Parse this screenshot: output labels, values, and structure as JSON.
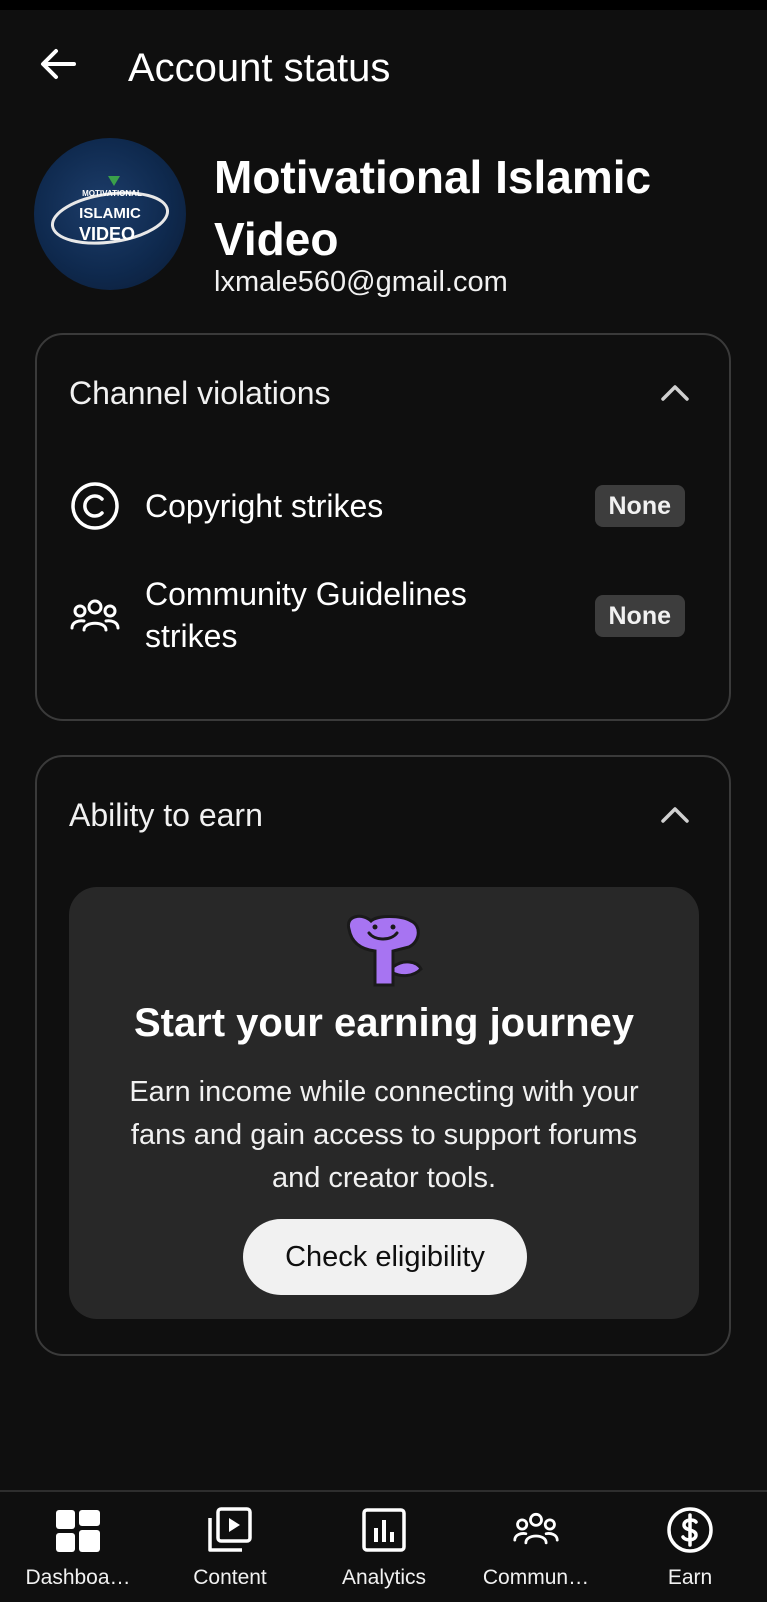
{
  "header": {
    "title": "Account status"
  },
  "channel": {
    "name": "Motivational Islamic Video",
    "email": "lxmale560@gmail.com",
    "avatar_text_top": "MOTIVATIONAL",
    "avatar_text_mid": "ISLAMIC",
    "avatar_text_bottom": "VIDEO"
  },
  "violations": {
    "title": "Channel violations",
    "items": [
      {
        "label": "Copyright strikes",
        "status": "None",
        "icon": "copyright-icon"
      },
      {
        "label": "Community Guidelines strikes",
        "status": "None",
        "icon": "people-icon"
      }
    ]
  },
  "earn": {
    "title": "Ability to earn",
    "card_title": "Start your earning journey",
    "card_desc": "Earn income while connecting with your fans and gain access to support forums and creator tools.",
    "button_label": "Check eligibility"
  },
  "nav": {
    "items": [
      {
        "label": "Dashboa…",
        "icon": "dashboard-icon"
      },
      {
        "label": "Content",
        "icon": "content-icon"
      },
      {
        "label": "Analytics",
        "icon": "analytics-icon"
      },
      {
        "label": "Commun…",
        "icon": "community-icon"
      },
      {
        "label": "Earn",
        "icon": "earn-icon"
      }
    ]
  },
  "colors": {
    "background": "#0f0f0f",
    "card_border": "#3a3a3a",
    "badge": "#3d3d3d",
    "mascot": "#a774f2"
  }
}
